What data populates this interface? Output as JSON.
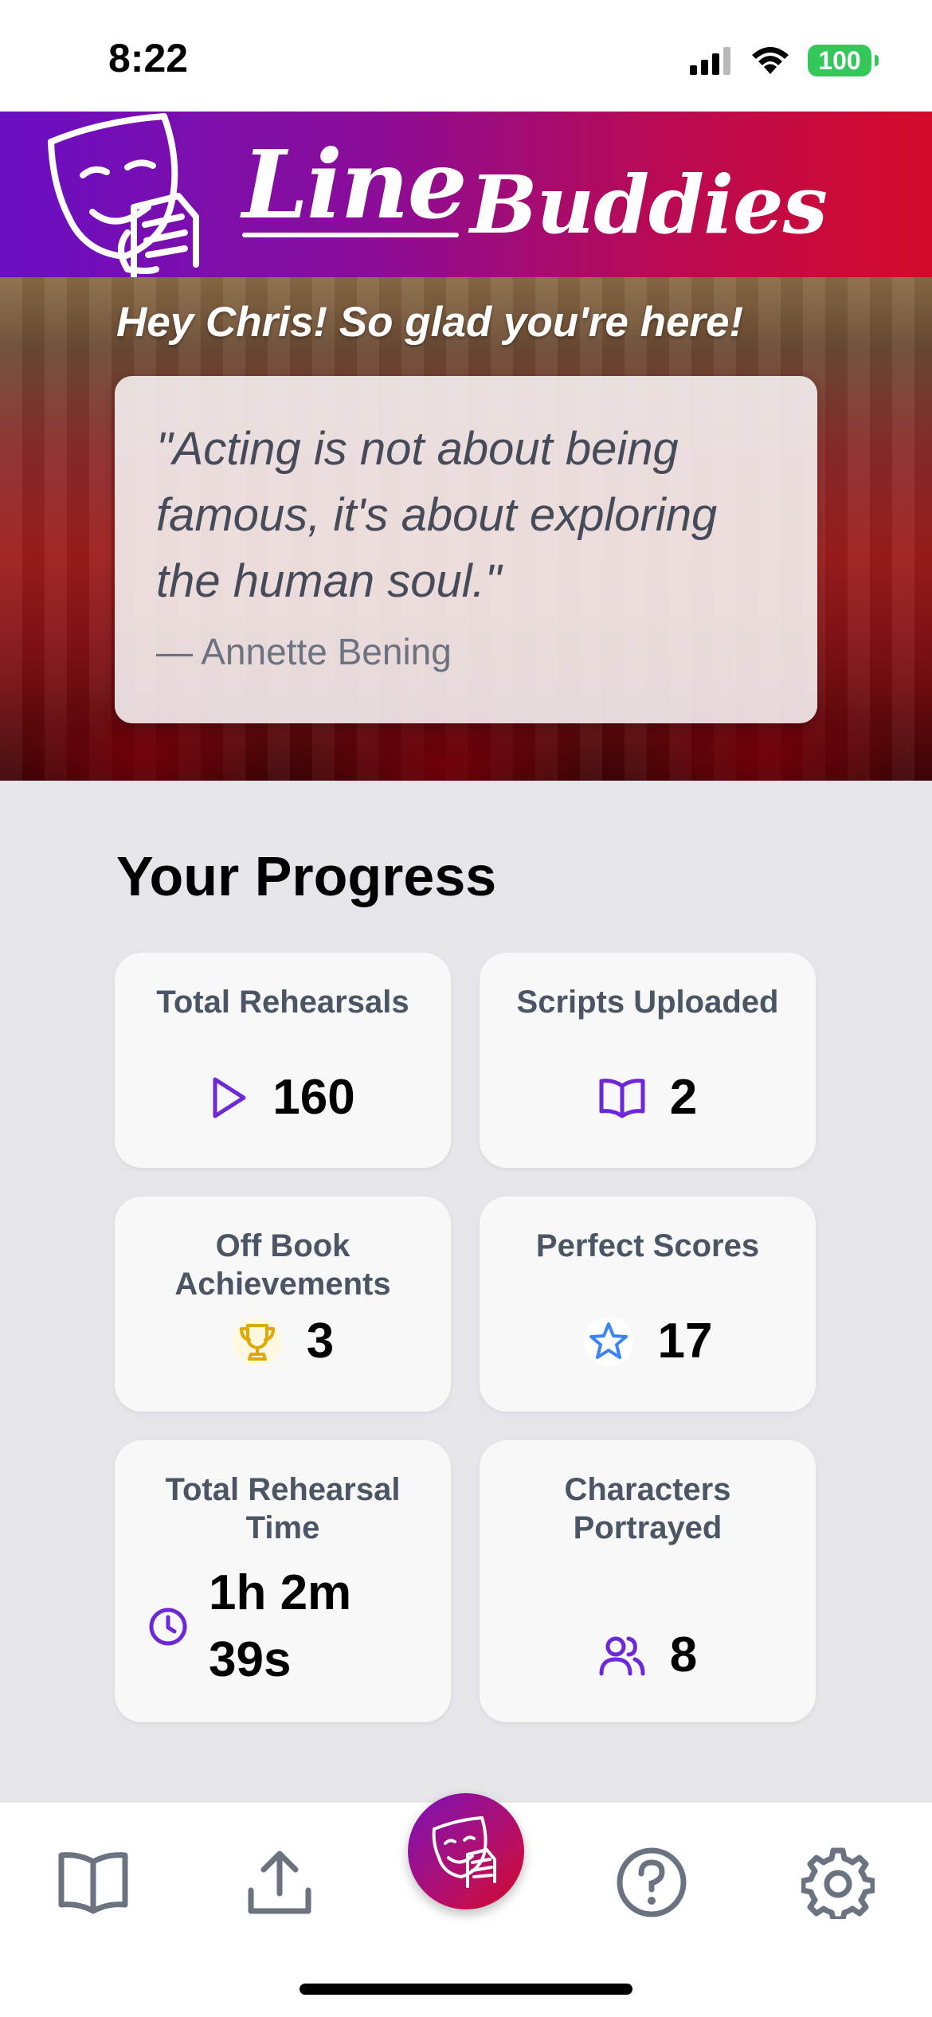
{
  "status_bar": {
    "time": "8:22",
    "battery": "100",
    "icons": [
      "signal-icon",
      "wifi-icon",
      "battery-icon"
    ]
  },
  "banner": {
    "logo_word_1": "Line",
    "logo_word_2": "Buddies",
    "logo_icon": "theater-mask-script-icon",
    "gradient_colors": [
      "#6a0fc4",
      "#d40a2a"
    ]
  },
  "hero": {
    "greeting": "Hey Chris! So glad you're here!",
    "quote": "\"Acting is not about being famous, it's about exploring the human soul.\"",
    "quote_author": "— Annette Bening"
  },
  "progress": {
    "title": "Your Progress",
    "cards": [
      {
        "label": "Total Rehearsals",
        "value": "160",
        "icon": "play-icon",
        "icon_color": "#6d28d9"
      },
      {
        "label": "Scripts Uploaded",
        "value": "2",
        "icon": "open-book-icon",
        "icon_color": "#6d28d9"
      },
      {
        "label": "Off Book Achievements",
        "value": "3",
        "icon": "trophy-icon",
        "icon_color": "#e0a800"
      },
      {
        "label": "Perfect Scores",
        "value": "17",
        "icon": "star-icon",
        "icon_color": "#3b82f6"
      },
      {
        "label": "Total Rehearsal Time",
        "value": "1h 2m 39s",
        "icon": "clock-icon",
        "icon_color": "#6d28d9"
      },
      {
        "label": "Characters Portrayed",
        "value": "8",
        "icon": "users-icon",
        "icon_color": "#6d28d9"
      }
    ]
  },
  "tab_bar": {
    "tabs": [
      "book-icon",
      "upload-icon",
      "theater-mask-icon",
      "help-icon",
      "settings-icon"
    ],
    "accent": "#6b7280"
  }
}
